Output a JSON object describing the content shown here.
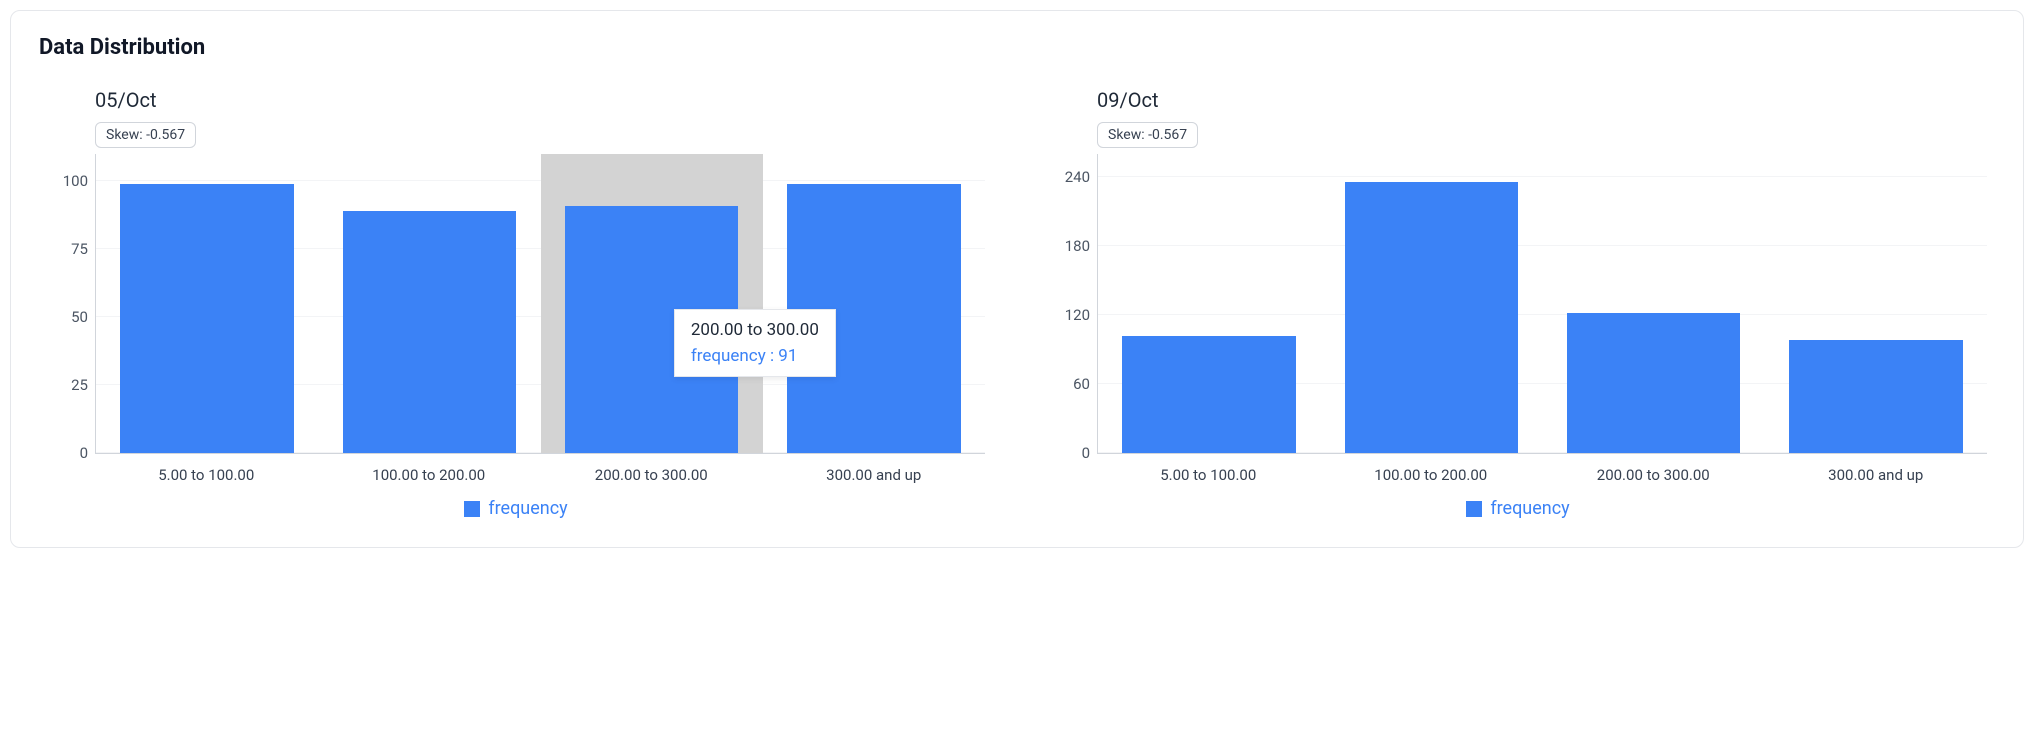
{
  "title": "Data Distribution",
  "legend_label": "frequency",
  "colors": {
    "bar": "#3b82f6",
    "highlight": "#d3d3d3"
  },
  "charts": [
    {
      "title": "05/Oct",
      "skew_label": "Skew: -0.567",
      "ylim": [
        0,
        110
      ],
      "y_ticks": [
        0,
        25,
        50,
        75,
        100
      ],
      "categories": [
        "5.00 to 100.00",
        "100.00 to 200.00",
        "200.00 to 300.00",
        "300.00 and up"
      ],
      "values": [
        99,
        89,
        91,
        99
      ],
      "tooltip": {
        "bar_index": 2,
        "title": "200.00 to 300.00",
        "series_label": "frequency",
        "value": 91
      }
    },
    {
      "title": "09/Oct",
      "skew_label": "Skew: -0.567",
      "ylim": [
        0,
        260
      ],
      "y_ticks": [
        0,
        60,
        120,
        180,
        240
      ],
      "categories": [
        "5.00 to 100.00",
        "100.00 to 200.00",
        "200.00 to 300.00",
        "300.00 and up"
      ],
      "values": [
        102,
        236,
        122,
        98
      ],
      "tooltip": null
    }
  ],
  "chart_data": [
    {
      "type": "bar",
      "title": "05/Oct",
      "annotation": "Skew: -0.567",
      "categories": [
        "5.00 to 100.00",
        "100.00 to 200.00",
        "200.00 to 300.00",
        "300.00 and up"
      ],
      "series": [
        {
          "name": "frequency",
          "values": [
            99,
            89,
            91,
            99
          ]
        }
      ],
      "xlabel": "",
      "ylabel": "",
      "ylim": [
        0,
        110
      ],
      "y_ticks": [
        0,
        25,
        50,
        75,
        100
      ],
      "legend_position": "bottom-center"
    },
    {
      "type": "bar",
      "title": "09/Oct",
      "annotation": "Skew: -0.567",
      "categories": [
        "5.00 to 100.00",
        "100.00 to 200.00",
        "200.00 to 300.00",
        "300.00 and up"
      ],
      "series": [
        {
          "name": "frequency",
          "values": [
            102,
            236,
            122,
            98
          ]
        }
      ],
      "xlabel": "",
      "ylabel": "",
      "ylim": [
        0,
        260
      ],
      "y_ticks": [
        0,
        60,
        120,
        180,
        240
      ],
      "legend_position": "bottom-center"
    }
  ]
}
